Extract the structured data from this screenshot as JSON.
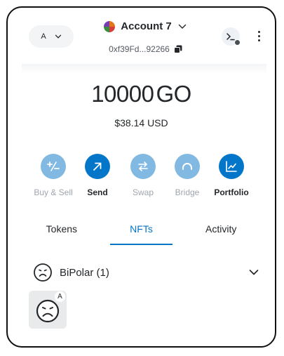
{
  "header": {
    "network_letter": "A",
    "account_name": "Account 7",
    "address": "0xf39Fd...92266"
  },
  "balance": {
    "amount": "10000",
    "ticker": "GO",
    "usd": "$38.14 USD"
  },
  "actions": [
    {
      "label": "Buy & Sell",
      "enabled": false
    },
    {
      "label": "Send",
      "enabled": true
    },
    {
      "label": "Swap",
      "enabled": false
    },
    {
      "label": "Bridge",
      "enabled": false
    },
    {
      "label": "Portfolio",
      "enabled": true
    }
  ],
  "tabs": [
    {
      "label": "Tokens",
      "active": false
    },
    {
      "label": "NFTs",
      "active": true
    },
    {
      "label": "Activity",
      "active": false
    }
  ],
  "nfts": {
    "collection_name": "BiPolar (1)",
    "item_badge": "A"
  },
  "colors": {
    "accent": "#0376c9",
    "accent_muted": "#81b9e3",
    "text": "#24272a"
  }
}
